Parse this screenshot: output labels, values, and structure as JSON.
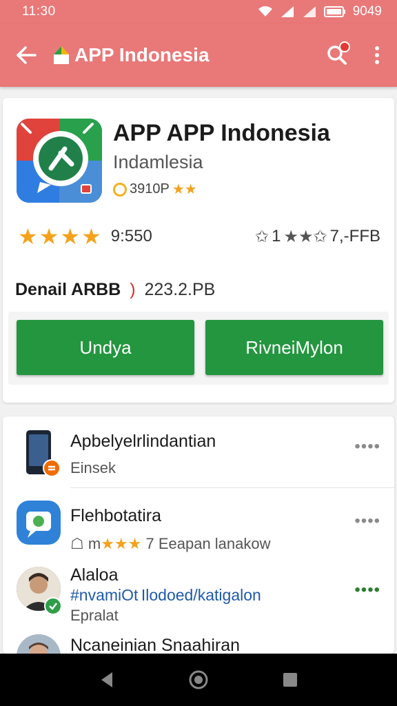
{
  "status_bar": {
    "time": "11:30",
    "battery": "9049"
  },
  "toolbar": {
    "title": "APP Indonesia"
  },
  "app": {
    "name": "APP APP Indonesia",
    "subtitle": "Indamlesia",
    "meta": "3910P",
    "rating_stars": "★★★★",
    "rating_value": "9:550",
    "rating_right_text": "1",
    "rating_right_value": "7,-FFB",
    "detail_label": "Denail ARBB",
    "detail_sep": ")",
    "detail_size": "223.2.PB",
    "button_left": "Undya",
    "button_right": "RivneiMylon"
  },
  "list": [
    {
      "title": "Apbelyelrlindantian",
      "subtitle": "Einsek",
      "more": "••••"
    },
    {
      "title": "Flehbotatira",
      "subtitle_prefix": "m",
      "subtitle_stars": "★★★",
      "subtitle_text": "7 Eeapan lanakow",
      "more": "••••"
    },
    {
      "title": "Alaloa",
      "tag_left": "#nvamiOt",
      "tag_right": "Ilodoed/katigalon",
      "subtitle": "Epralat",
      "more": "••••"
    },
    {
      "title": "Ncaneinian Snaahiran"
    }
  ],
  "colors": {
    "toolbar": "#e97878",
    "primary_button": "#23963f",
    "star": "#f4a21c"
  }
}
